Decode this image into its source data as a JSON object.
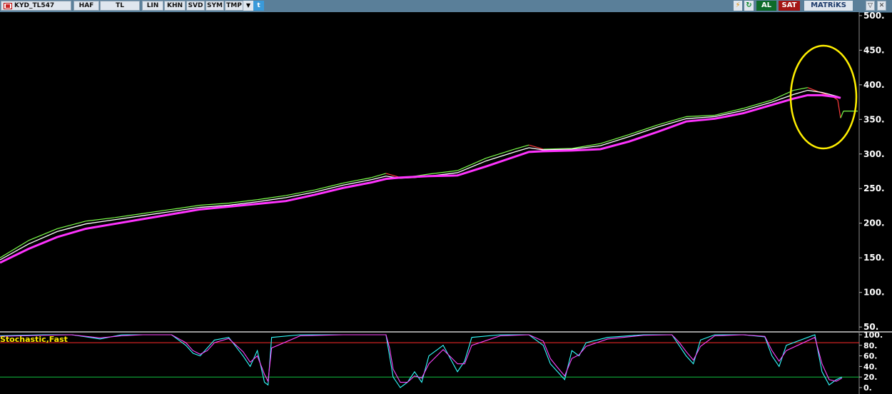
{
  "toolbar": {
    "symbol": "KYD_TL547",
    "symbol_icon": "flag-icon",
    "buttons": [
      "HAF",
      "TL",
      "LIN",
      "KHN",
      "SVD",
      "SYM",
      "TMP"
    ],
    "dropdown_icon": "dropdown-arrow-icon",
    "share_icon": "twitter-bird-icon",
    "bolt_icon": "lightning-icon",
    "refresh_icon": "refresh-icon",
    "buy_label": "AL",
    "sell_label": "SAT",
    "brand": "MATRiKS",
    "window_controls": [
      "collapse-icon",
      "close-icon"
    ],
    "buy_color": "#0e6b2a",
    "sell_color": "#a41515"
  },
  "indicator_label": "Stochastic,Fast",
  "chart_data": [
    {
      "type": "line",
      "name": "price-panel",
      "yaxis_ticks": [
        "500.",
        "450.",
        "400.",
        "350.",
        "300.",
        "250.",
        "200.",
        "150.",
        "100.",
        "50."
      ],
      "ylim": [
        45,
        505
      ],
      "highlight": "yellow ellipse around the most recent sharp drop",
      "series": [
        {
          "role": "price",
          "color_up": "#7cff4a",
          "color_down": "#ff3b3b",
          "x": [
            0,
            40,
            80,
            120,
            160,
            200,
            240,
            280,
            320,
            360,
            400,
            440,
            480,
            520,
            540,
            560,
            580,
            600,
            640,
            680,
            720,
            740,
            760,
            800,
            840,
            880,
            920,
            960,
            1000,
            1040,
            1080,
            1110,
            1130,
            1150,
            1165,
            1172,
            1176,
            1180,
            1200
          ],
          "y": [
            150,
            175,
            192,
            203,
            208,
            214,
            220,
            226,
            229,
            234,
            240,
            248,
            258,
            266,
            272,
            266,
            268,
            271,
            276,
            294,
            307,
            313,
            307,
            308,
            315,
            328,
            342,
            354,
            356,
            366,
            378,
            392,
            396,
            388,
            383,
            378,
            352,
            362,
            362
          ]
        },
        {
          "role": "ma-short",
          "color": "#ffffff",
          "x": [
            0,
            40,
            80,
            120,
            160,
            200,
            240,
            280,
            320,
            360,
            400,
            440,
            480,
            520,
            540,
            560,
            580,
            600,
            640,
            680,
            720,
            740,
            760,
            800,
            840,
            880,
            920,
            960,
            1000,
            1040,
            1080,
            1110,
            1130,
            1150,
            1165,
            1172,
            1176
          ],
          "y": [
            147,
            170,
            188,
            199,
            205,
            211,
            217,
            223,
            226,
            231,
            237,
            245,
            255,
            263,
            268,
            265,
            266,
            268,
            273,
            290,
            303,
            309,
            306,
            307,
            312,
            325,
            339,
            351,
            354,
            363,
            375,
            386,
            392,
            389,
            385,
            383,
            381
          ]
        },
        {
          "role": "ma-long",
          "color": "#ff33ff",
          "x": [
            0,
            40,
            80,
            120,
            160,
            200,
            240,
            280,
            320,
            360,
            400,
            440,
            480,
            520,
            540,
            560,
            580,
            600,
            640,
            680,
            720,
            740,
            760,
            800,
            840,
            880,
            920,
            960,
            1000,
            1040,
            1080,
            1110,
            1130,
            1150,
            1165,
            1172,
            1176
          ],
          "y": [
            143,
            163,
            180,
            192,
            199,
            206,
            213,
            220,
            224,
            228,
            232,
            241,
            251,
            259,
            264,
            266,
            267,
            268,
            269,
            282,
            296,
            303,
            304,
            305,
            307,
            318,
            332,
            347,
            351,
            359,
            371,
            380,
            385,
            385,
            383,
            382,
            381
          ]
        }
      ]
    },
    {
      "type": "line",
      "name": "stochastic-fast",
      "yaxis_ticks": [
        "100.",
        "80.",
        "60.",
        "40.",
        "20.",
        "0."
      ],
      "ylim": [
        0,
        100
      ],
      "reference_lines": [
        {
          "value": 85,
          "color": "#ff2a2a"
        },
        {
          "value": 20,
          "color": "#10c040"
        }
      ],
      "series": [
        {
          "role": "%K",
          "color": "#33ffff",
          "x": [
            0,
            60,
            100,
            140,
            170,
            200,
            240,
            260,
            270,
            280,
            290,
            300,
            320,
            340,
            350,
            360,
            370,
            375,
            380,
            420,
            480,
            540,
            545,
            550,
            560,
            570,
            580,
            590,
            600,
            620,
            640,
            650,
            660,
            700,
            740,
            760,
            770,
            780,
            790,
            800,
            810,
            820,
            850,
            900,
            940,
            950,
            960,
            970,
            980,
            1000,
            1040,
            1070,
            1080,
            1090,
            1100,
            1140,
            1150,
            1160,
            1170,
            1178
          ],
          "y": [
            98,
            100,
            100,
            92,
            100,
            100,
            100,
            80,
            65,
            60,
            75,
            90,
            95,
            60,
            40,
            70,
            10,
            5,
            95,
            100,
            100,
            100,
            60,
            20,
            0,
            10,
            30,
            10,
            60,
            80,
            30,
            50,
            95,
            100,
            100,
            80,
            45,
            30,
            15,
            70,
            60,
            85,
            95,
            100,
            100,
            80,
            60,
            45,
            90,
            100,
            100,
            96,
            60,
            40,
            80,
            100,
            30,
            5,
            15,
            20
          ]
        },
        {
          "role": "%D",
          "color": "#ff44ff",
          "x": [
            0,
            60,
            100,
            140,
            170,
            200,
            240,
            260,
            270,
            280,
            290,
            300,
            320,
            340,
            350,
            360,
            370,
            375,
            380,
            420,
            480,
            540,
            545,
            550,
            560,
            570,
            580,
            590,
            600,
            620,
            640,
            650,
            660,
            700,
            740,
            760,
            770,
            780,
            790,
            800,
            810,
            820,
            850,
            900,
            940,
            950,
            960,
            970,
            980,
            1000,
            1040,
            1070,
            1080,
            1090,
            1100,
            1140,
            1150,
            1160,
            1170,
            1178
          ],
          "y": [
            97,
            99,
            100,
            94,
            98,
            100,
            100,
            85,
            70,
            63,
            70,
            85,
            93,
            68,
            48,
            60,
            25,
            12,
            75,
            98,
            100,
            100,
            75,
            35,
            10,
            10,
            22,
            18,
            45,
            72,
            45,
            45,
            80,
            98,
            100,
            88,
            55,
            38,
            22,
            55,
            62,
            78,
            92,
            99,
            100,
            86,
            68,
            52,
            78,
            98,
            100,
            97,
            70,
            50,
            70,
            95,
            45,
            15,
            12,
            18
          ]
        }
      ]
    }
  ]
}
